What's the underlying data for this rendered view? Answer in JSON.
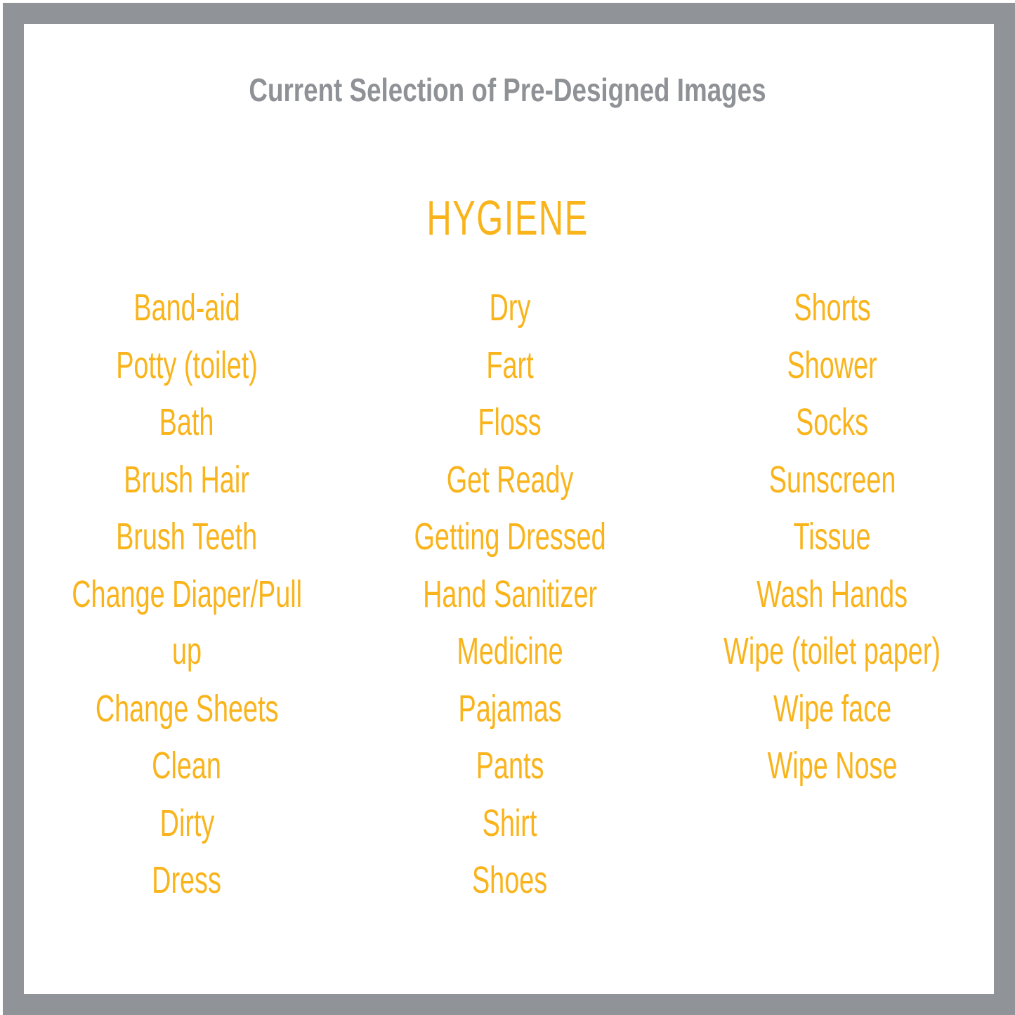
{
  "header": {
    "title": "Current Selection of Pre-Designed Images",
    "title_color": "#8e9195"
  },
  "category": {
    "heading": "HYGIENE",
    "accent_color": "#f9b41c"
  },
  "frame": {
    "border_color": "#909499",
    "background_color": "#ffffff"
  },
  "columns": [
    {
      "name": "column-1",
      "items": [
        "Band-aid",
        "Potty (toilet)",
        "Bath",
        "Brush Hair",
        "Brush Teeth",
        "Change Diaper/Pull",
        "up",
        "Change Sheets",
        "Clean",
        "Dirty",
        "Dress"
      ]
    },
    {
      "name": "column-2",
      "items": [
        "Dry",
        "Fart",
        "Floss",
        "Get Ready",
        "Getting Dressed",
        "Hand Sanitizer",
        "Medicine",
        "Pajamas",
        "Pants",
        "Shirt",
        "Shoes"
      ]
    },
    {
      "name": "column-3",
      "items": [
        "Shorts",
        "Shower",
        "Socks",
        "Sunscreen",
        "Tissue",
        "Wash Hands",
        "Wipe (toilet paper)",
        "Wipe face",
        "Wipe Nose"
      ]
    }
  ]
}
